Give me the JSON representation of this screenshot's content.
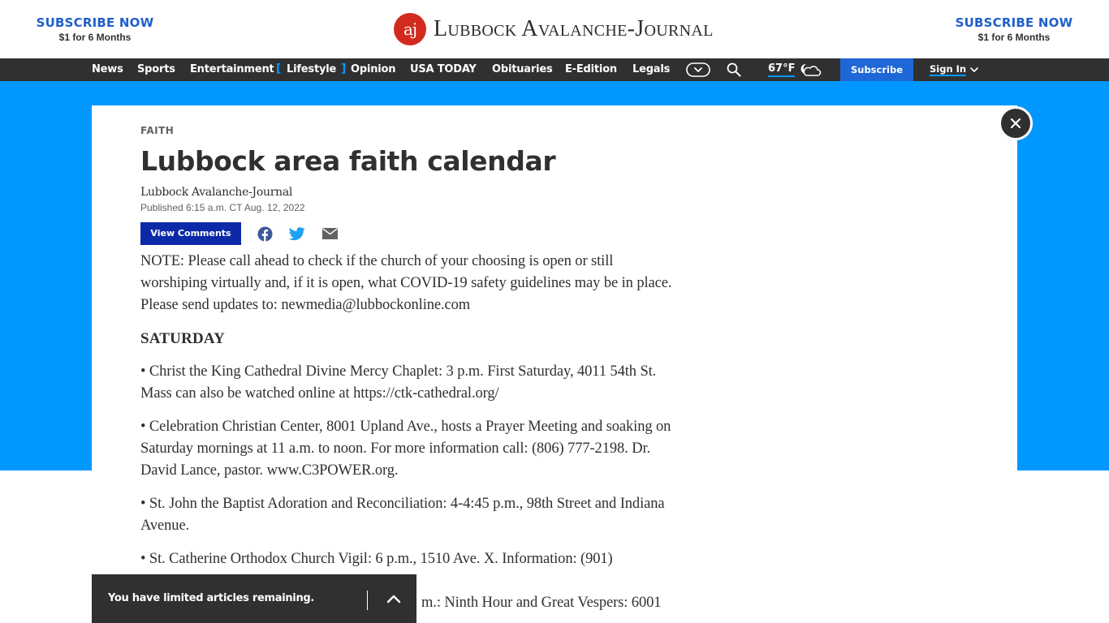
{
  "header": {
    "promo_left": {
      "headline": "SUBSCRIBE NOW",
      "offer": "$1 for 6 Months"
    },
    "promo_right": {
      "headline": "SUBSCRIBE NOW",
      "offer": "$1 for 6 Months"
    },
    "logo": {
      "mark": "aj",
      "name": "Lubbock Avalanche-Journal"
    }
  },
  "nav": {
    "items": [
      {
        "label": "News"
      },
      {
        "label": "Sports"
      },
      {
        "label": "Entertainment"
      },
      {
        "label": "Lifestyle",
        "active": true
      },
      {
        "label": "Opinion"
      },
      {
        "label": "USA TODAY"
      },
      {
        "label": "Obituaries"
      },
      {
        "label": "E-Edition"
      },
      {
        "label": "Legals"
      }
    ],
    "bracket_open": "[",
    "bracket_close": "]",
    "more_icon": "chevron-circle-down-icon",
    "search_icon": "search-icon",
    "weather": {
      "temperature": "67°F",
      "icon": "partly-cloudy-night-icon"
    },
    "subscribe_label": "Subscribe",
    "signin_label": "Sign In"
  },
  "colors": {
    "brand_blue": "#0098ff",
    "nav_bg": "#303030",
    "subscribe_blue": "#1f67d6",
    "comments_blue": "#0c2aa8",
    "promo_blue": "#1f5fcc",
    "logo_red": "#d32a1f"
  },
  "article": {
    "section": "FAITH",
    "headline": "Lubbock area faith calendar",
    "byline": "Lubbock Avalanche-Journal",
    "published": "Published 6:15 a.m. CT Aug. 12, 2022",
    "view_comments_label": "View Comments",
    "share_icons": [
      "facebook-icon",
      "twitter-icon",
      "email-icon"
    ],
    "note": "NOTE: Please call ahead to check if the church of your choosing is open or still worshiping virtually and, if it is open, what COVID-19 safety guidelines may be in place. Please send updates to: newmedia@lubbockonline.com",
    "day_heading": "SATURDAY",
    "entries": [
      "• Christ the King Cathedral Divine Mercy Chaplet: 3 p.m. First Saturday, 4011 54th St. Mass can also be watched online at https://ctk-cathedral.org/",
      "• Celebration Christian Center, 8001 Upland Ave., hosts a Prayer Meeting and soaking on Saturday mornings at 11 a.m. to noon. For more information call: (806) 777-2198. Dr. David Lance, pastor. www.C3POWER.org.",
      "• St. John the Baptist Adoration and Reconciliation: 4-4:45 p.m., 98th Street and Indiana Avenue.",
      "• St. Catherine Orthodox Church Vigil: 6 p.m., 1510 Ave. X. Information: (901)",
      "m.: Ninth Hour and Great Vespers: 6001"
    ]
  },
  "meter": {
    "message": "You have limited articles remaining.",
    "expand_icon": "chevron-up-icon"
  },
  "close_icon": "close-icon"
}
